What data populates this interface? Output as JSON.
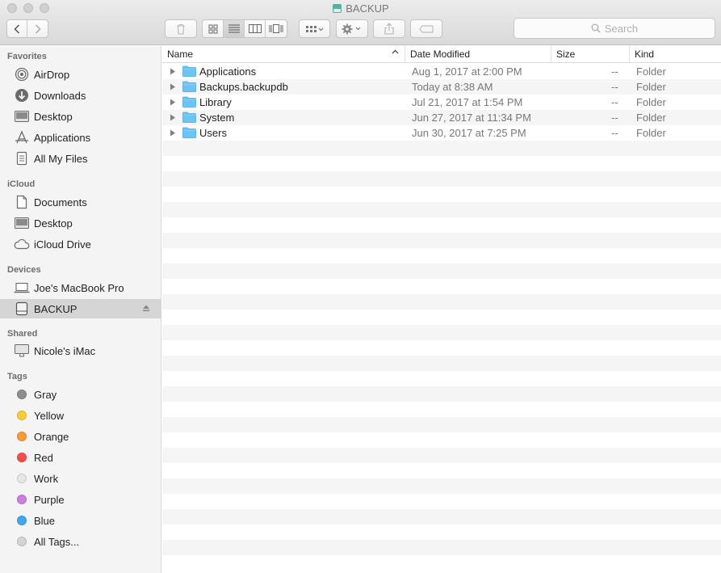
{
  "window": {
    "title": "BACKUP"
  },
  "toolbar": {
    "search_placeholder": "Search"
  },
  "sidebar": {
    "sections": [
      {
        "title": "Favorites",
        "items": [
          {
            "label": "AirDrop",
            "icon": "airdrop-icon"
          },
          {
            "label": "Downloads",
            "icon": "downloads-icon"
          },
          {
            "label": "Desktop",
            "icon": "desktop-icon"
          },
          {
            "label": "Applications",
            "icon": "applications-icon"
          },
          {
            "label": "All My Files",
            "icon": "all-my-files-icon"
          }
        ]
      },
      {
        "title": "iCloud",
        "items": [
          {
            "label": "Documents",
            "icon": "documents-icon"
          },
          {
            "label": "Desktop",
            "icon": "desktop-icon"
          },
          {
            "label": "iCloud Drive",
            "icon": "cloud-icon"
          }
        ]
      },
      {
        "title": "Devices",
        "items": [
          {
            "label": "Joe's MacBook Pro",
            "icon": "laptop-icon"
          },
          {
            "label": "BACKUP",
            "icon": "drive-icon",
            "selected": true
          }
        ]
      },
      {
        "title": "Shared",
        "items": [
          {
            "label": "Nicole's iMac",
            "icon": "imac-icon"
          }
        ]
      },
      {
        "title": "Tags",
        "items": [
          {
            "label": "Gray",
            "color": "#8e8e8e"
          },
          {
            "label": "Yellow",
            "color": "#fbcc33"
          },
          {
            "label": "Orange",
            "color": "#fb9a34"
          },
          {
            "label": "Red",
            "color": "#fb4c4c"
          },
          {
            "label": "Work",
            "color": "#e6e6e6"
          },
          {
            "label": "Purple",
            "color": "#cb7fe3"
          },
          {
            "label": "Blue",
            "color": "#3fa8f4"
          },
          {
            "label": "All Tags...",
            "color": "#d4d4d4"
          }
        ]
      }
    ]
  },
  "columns": {
    "name": "Name",
    "date": "Date Modified",
    "size": "Size",
    "kind": "Kind"
  },
  "files": [
    {
      "name": "Applications",
      "date": "Aug 1, 2017 at 2:00 PM",
      "size": "--",
      "kind": "Folder"
    },
    {
      "name": "Backups.backupdb",
      "date": "Today at 8:38 AM",
      "size": "--",
      "kind": "Folder"
    },
    {
      "name": "Library",
      "date": "Jul 21, 2017 at 1:54 PM",
      "size": "--",
      "kind": "Folder"
    },
    {
      "name": "System",
      "date": "Jun 27, 2017 at 11:34 PM",
      "size": "--",
      "kind": "Folder"
    },
    {
      "name": "Users",
      "date": "Jun 30, 2017 at 7:25 PM",
      "size": "--",
      "kind": "Folder"
    }
  ],
  "colors": {
    "folder": "#6cc3f4",
    "selected_row": "#d5d5d5"
  }
}
